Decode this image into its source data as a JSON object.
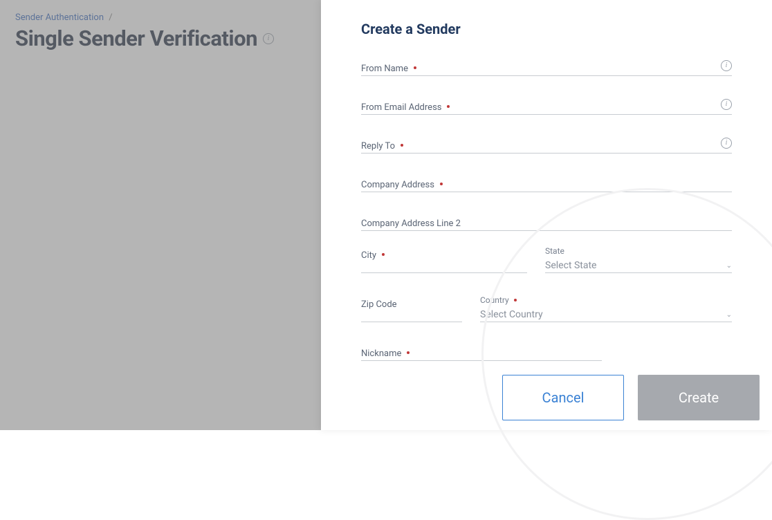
{
  "breadcrumb": {
    "parent": "Sender Authentication",
    "sep": "/"
  },
  "pageTitle": "Single Sender Verification",
  "panel": {
    "title": "Create a Sender",
    "fields": {
      "fromName": "From Name",
      "fromEmail": "From Email Address",
      "replyTo": "Reply To",
      "companyAddress": "Company Address",
      "companyAddress2": "Company Address Line 2",
      "city": "City",
      "stateLabel": "State",
      "statePlaceholder": "Select State",
      "zip": "Zip Code",
      "countryLabel": "Country",
      "countryPlaceholder": "Select Country",
      "nickname": "Nickname"
    },
    "buttons": {
      "cancel": "Cancel",
      "create": "Create"
    }
  }
}
